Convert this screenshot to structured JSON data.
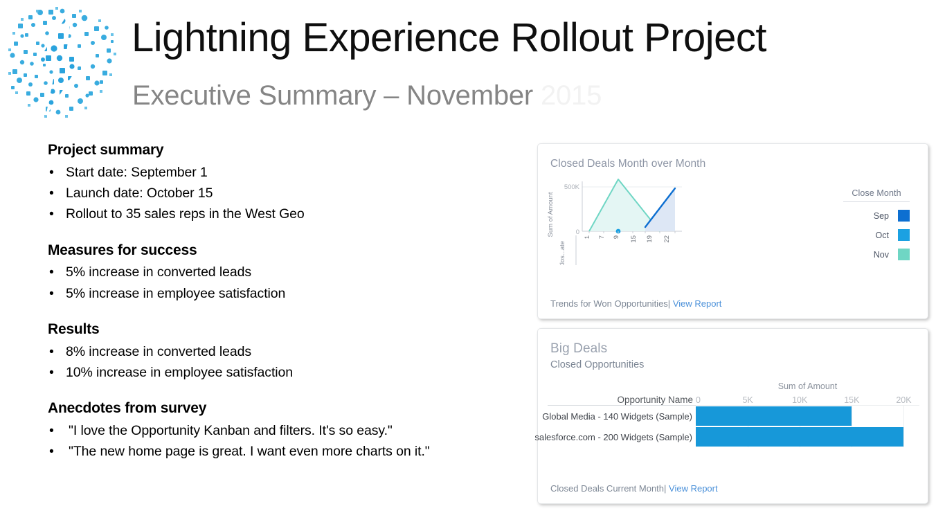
{
  "header": {
    "title": "Lightning Experience Rollout Project",
    "subtitle_main": "Executive Summary – November ",
    "subtitle_year": "2015",
    "logo_name": "lightning-bolt-logo"
  },
  "colors": {
    "brand_blue": "#1798d9",
    "sep": "#0d6fd1",
    "oct": "#1ba1e2",
    "nov": "#6fd6c4",
    "link": "#4a90d9",
    "subtitle_gray": "#858585"
  },
  "content": {
    "blocks": [
      {
        "heading": "Project summary",
        "bullets": [
          "Start date: September 1",
          "Launch date: October 15",
          "Rollout to 35 sales reps in the West Geo"
        ]
      },
      {
        "heading": "Measures for success",
        "bullets": [
          "5% increase in converted leads",
          "5% increase in employee satisfaction"
        ]
      },
      {
        "heading": "Results",
        "bullets": [
          "8% increase in converted leads",
          "10% increase in employee satisfaction"
        ]
      },
      {
        "heading": "Anecdotes from survey",
        "bullets": [
          "\"I love the Opportunity Kanban and filters. It's so easy.\"",
          "\"The new home page is great. I want even more charts on it.\""
        ]
      }
    ],
    "bullet_glyph": "•"
  },
  "cards": {
    "trends": {
      "title": "Closed Deals Month over Month",
      "footer_text": "Trends for Won Opportunities|",
      "footer_link": "View Report",
      "legend_title": "Close Month"
    },
    "bigdeals": {
      "title": "Big Deals",
      "subtitle": "Closed Opportunities",
      "footer_text": "Closed Deals Current Month|",
      "footer_link": "View Report"
    }
  },
  "chart_data": [
    {
      "type": "line",
      "title": "Closed Deals Month over Month",
      "xlabel": "Clos...ate",
      "ylabel": "Sum of Amount",
      "x_ticks": [
        "1",
        "7",
        "9",
        "15",
        "19",
        "22"
      ],
      "y_ticks": [
        "0",
        "500K"
      ],
      "ylim": [
        0,
        650000
      ],
      "xlim": [
        1,
        22
      ],
      "grid": true,
      "legend": {
        "title": "Close Month",
        "position": "right",
        "entries": [
          {
            "name": "Sep",
            "color": "#0d6fd1"
          },
          {
            "name": "Oct",
            "color": "#1ba1e2"
          },
          {
            "name": "Nov",
            "color": "#6fd6c4"
          }
        ]
      },
      "series": [
        {
          "name": "Nov",
          "color": "#6fd6c4",
          "fill": "#e2f7f6",
          "points": [
            {
              "x": 1,
              "y": 0
            },
            {
              "x": 7,
              "y": 620000
            },
            {
              "x": 19,
              "y": 0
            }
          ]
        },
        {
          "name": "Sep",
          "color": "#0d6fd1",
          "fill": "#dde7f5",
          "points": [
            {
              "x": 15,
              "y": 45000
            },
            {
              "x": 22,
              "y": 500000
            }
          ]
        },
        {
          "name": "Oct",
          "color": "#1ba1e2",
          "fill": "none",
          "points": [
            {
              "x": 9,
              "y": 0
            }
          ]
        }
      ]
    },
    {
      "type": "bar",
      "orientation": "horizontal",
      "title": "Big Deals",
      "subtitle": "Closed Opportunities",
      "xlabel": "Sum of Amount",
      "ylabel": "Opportunity Name",
      "x_ticks": [
        "0",
        "5K",
        "10K",
        "15K",
        "20K"
      ],
      "xlim": [
        0,
        21500
      ],
      "grid": true,
      "bar_color": "#1798d9",
      "categories": [
        "Global Media - 140 Widgets (Sample)",
        "salesforce.com - 200 Widgets (Sample)"
      ],
      "values": [
        15000,
        20000
      ]
    }
  ]
}
